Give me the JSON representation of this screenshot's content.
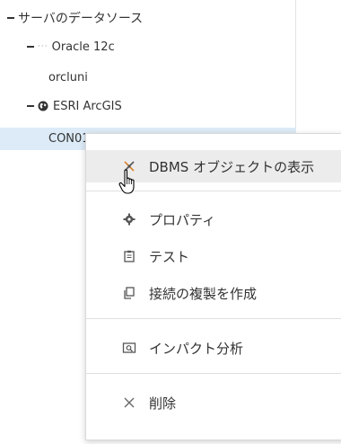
{
  "tree": {
    "root_label": "サーバのデータソース",
    "oracle_label": "Oracle 12c",
    "oracle_dots": "···",
    "orcluni_label": "orcluni",
    "esri_label": "ESRI ArcGIS",
    "con_label": "CON01"
  },
  "context_menu": {
    "items": [
      {
        "label": "DBMS オブジェクトの表示",
        "icon": "dbms-objects-icon"
      },
      {
        "label": "プロパティ",
        "icon": "gear-icon"
      },
      {
        "label": "テスト",
        "icon": "clipboard-icon"
      },
      {
        "label": "接続の複製を作成",
        "icon": "copy-icon"
      },
      {
        "label": "インパクト分析",
        "icon": "analysis-icon"
      },
      {
        "label": "削除",
        "icon": "close-icon"
      }
    ]
  },
  "colors": {
    "selection": "#dcebf7",
    "hover": "#ececec",
    "accent_x": "#d9822b"
  }
}
